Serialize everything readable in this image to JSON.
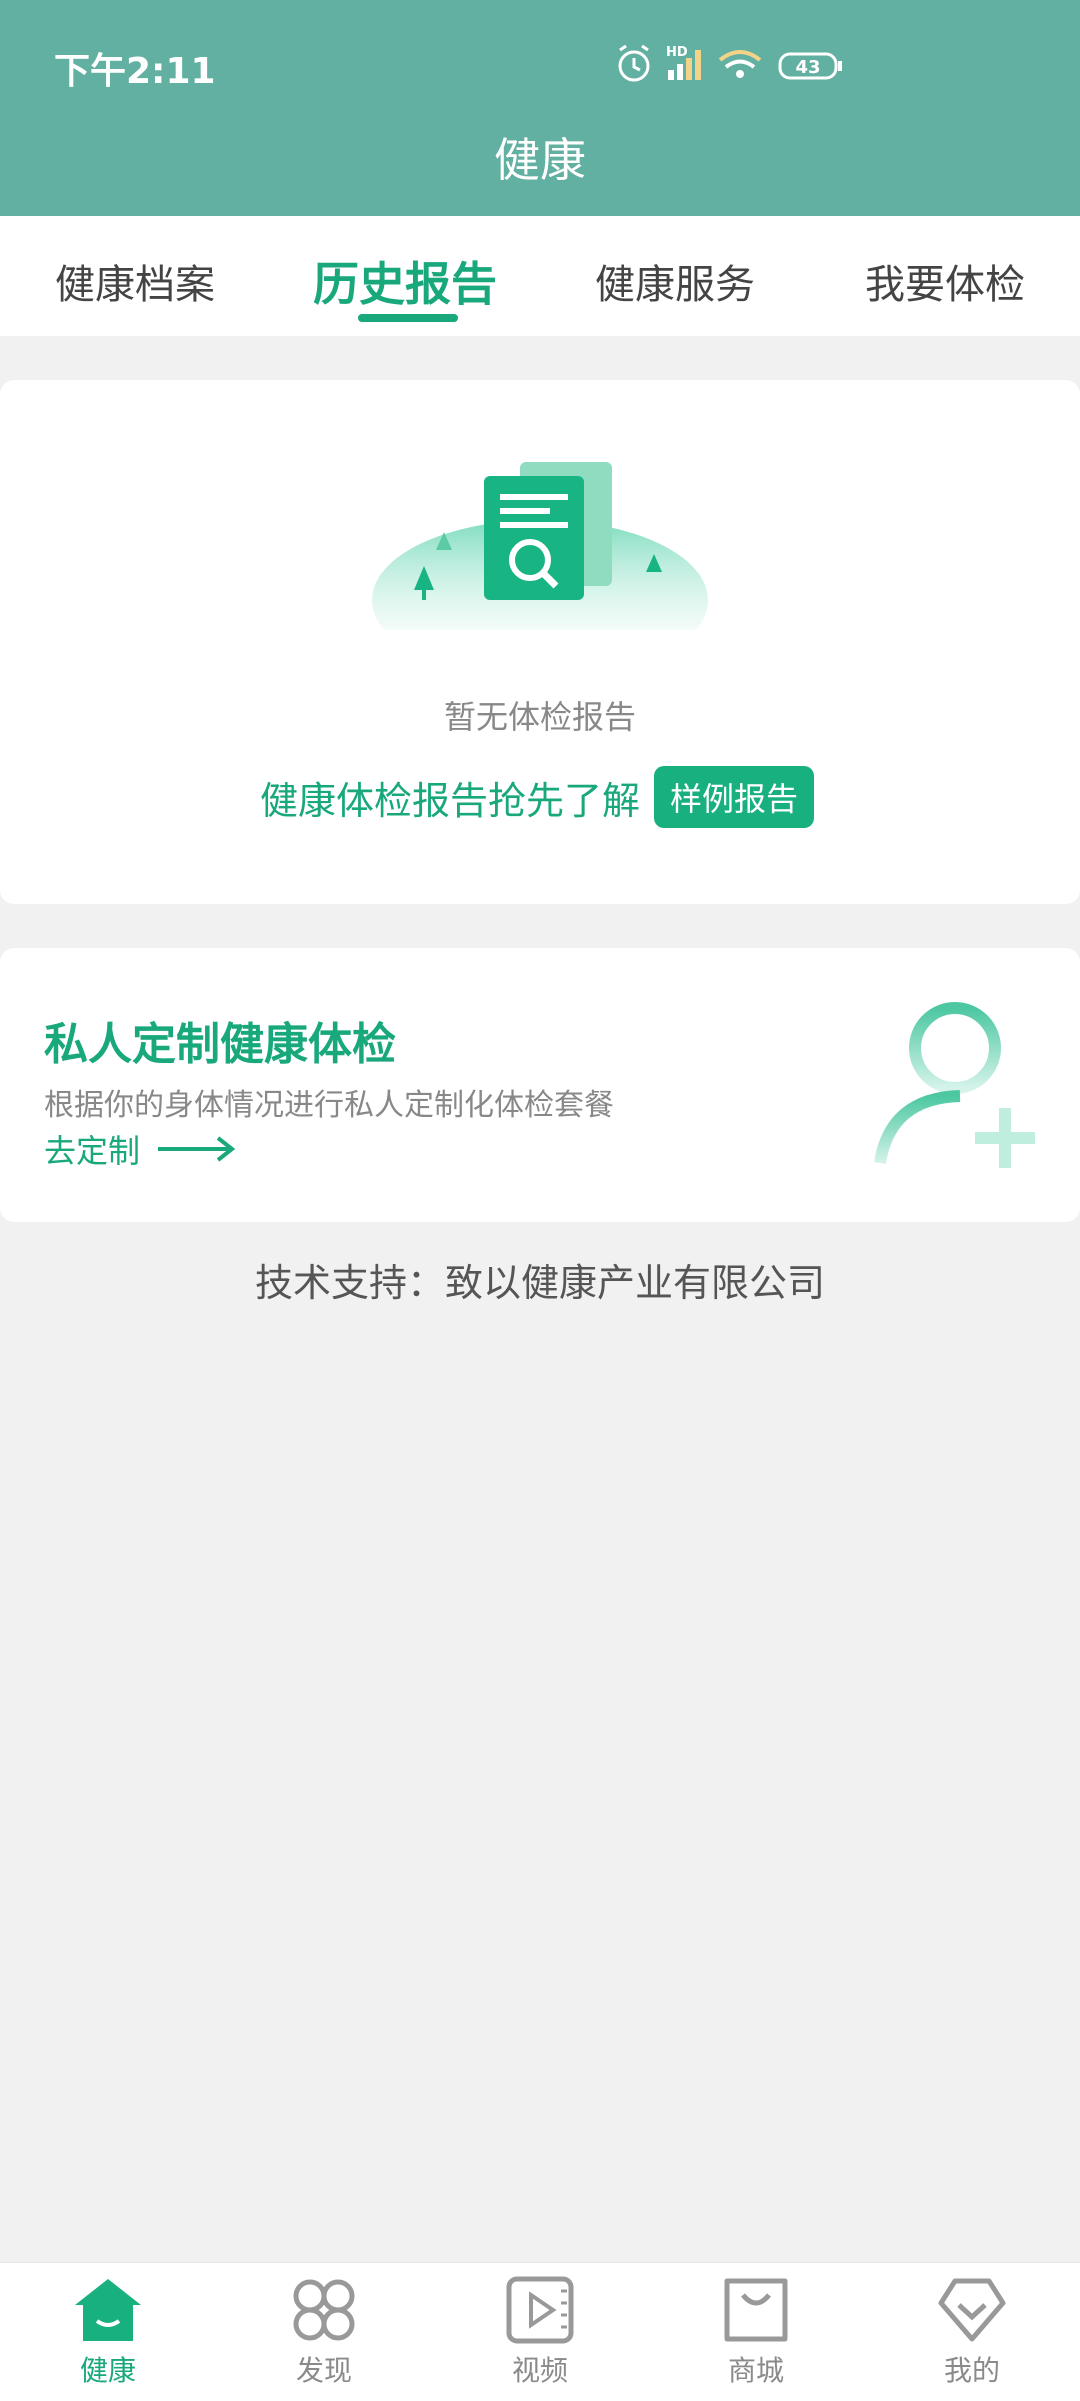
{
  "status_bar": {
    "time": "下午2:11",
    "network_label": "HD",
    "battery": "43"
  },
  "header": {
    "title": "健康"
  },
  "tabs": [
    {
      "label": "健康档案",
      "active": false
    },
    {
      "label": "历史报告",
      "active": true
    },
    {
      "label": "健康服务",
      "active": false
    },
    {
      "label": "我要体检",
      "active": false
    }
  ],
  "empty_state": {
    "message": "暂无体检报告",
    "promo_text": "健康体检报告抢先了解",
    "sample_button": "样例报告"
  },
  "custom_exam": {
    "title": "私人定制健康体检",
    "subtitle": "根据你的身体情况进行私人定制化体检套餐",
    "link": "去定制"
  },
  "footer": {
    "support_text": "技术支持：致以健康产业有限公司"
  },
  "bottom_nav": [
    {
      "label": "健康",
      "icon": "home-icon",
      "active": true
    },
    {
      "label": "发现",
      "icon": "discover-icon",
      "active": false
    },
    {
      "label": "视频",
      "icon": "video-icon",
      "active": false
    },
    {
      "label": "商城",
      "icon": "shop-bag-icon",
      "active": false
    },
    {
      "label": "我的",
      "icon": "profile-icon",
      "active": false
    }
  ],
  "colors": {
    "header": "#62b0a1",
    "accent": "#18a87c",
    "background": "#f1f1f1"
  }
}
